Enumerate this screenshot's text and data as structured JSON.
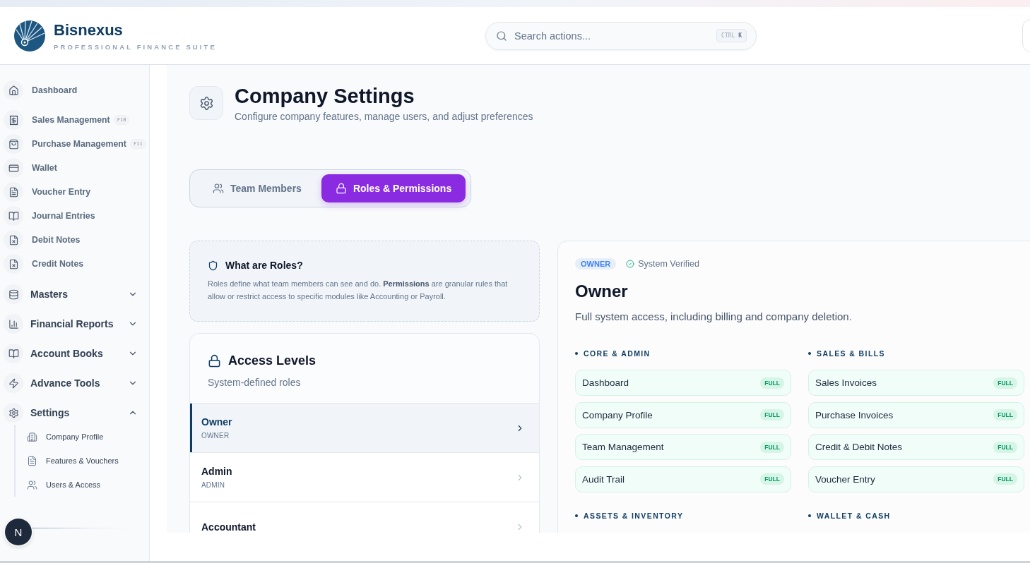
{
  "brand": {
    "name": "Bisnexus",
    "tagline": "PROFESSIONAL FINANCE SUITE"
  },
  "search": {
    "placeholder": "Search actions...",
    "shortcut": "CTRL **K**"
  },
  "sidebar": {
    "items": [
      {
        "kind": "link",
        "label": "Dashboard"
      },
      {
        "kind": "link",
        "label": "Sales Management",
        "shortcut": "F10"
      },
      {
        "kind": "link",
        "label": "Purchase Management",
        "shortcut": "F11"
      },
      {
        "kind": "link",
        "label": "Wallet"
      },
      {
        "kind": "link",
        "label": "Voucher Entry"
      },
      {
        "kind": "link",
        "label": "Journal Entries"
      },
      {
        "kind": "link",
        "label": "Debit Notes"
      },
      {
        "kind": "link",
        "label": "Credit Notes"
      },
      {
        "kind": "group",
        "label": "Masters",
        "expanded": false
      },
      {
        "kind": "group",
        "label": "Financial Reports",
        "expanded": false
      },
      {
        "kind": "group",
        "label": "Account Books",
        "expanded": false
      },
      {
        "kind": "group",
        "label": "Advance Tools",
        "expanded": false
      },
      {
        "kind": "group",
        "label": "Settings",
        "expanded": true,
        "children": [
          {
            "label": "Company Profile"
          },
          {
            "label": "Features & Vouchers"
          },
          {
            "label": "Users & Access"
          }
        ]
      }
    ],
    "avatar": "N"
  },
  "page": {
    "title": "Company Settings",
    "subtitle": "Configure company features, manage users, and adjust preferences"
  },
  "tabs": [
    {
      "label": "Team Members",
      "selected": false
    },
    {
      "label": "Roles & Permissions",
      "selected": true
    }
  ],
  "info": {
    "title": "What are Roles?",
    "text": "Roles define what team members can see and do. **Permissions** are granular rules that allow or restrict access to specific modules like Accounting or Payroll."
  },
  "access_levels": {
    "title": "Access Levels",
    "subtitle": "System-defined roles",
    "roles": [
      {
        "name": "Owner",
        "code": "OWNER",
        "selected": true
      },
      {
        "name": "Admin",
        "code": "ADMIN",
        "selected": false
      },
      {
        "name": "Accountant",
        "selected": false
      }
    ]
  },
  "role_detail": {
    "badge": "OWNER",
    "status": "System Verified",
    "title": "Owner",
    "description": "Full system access, including billing and company deletion.",
    "sections": [
      {
        "title": "CORE & ADMIN",
        "permissions": [
          {
            "name": "Dashboard",
            "access": "FULL"
          },
          {
            "name": "Company Profile",
            "access": "FULL"
          },
          {
            "name": "Team Management",
            "access": "FULL"
          },
          {
            "name": "Audit Trail",
            "access": "FULL"
          }
        ]
      },
      {
        "title": "SALES & BILLS",
        "permissions": [
          {
            "name": "Sales Invoices",
            "access": "FULL"
          },
          {
            "name": "Purchase Invoices",
            "access": "FULL"
          },
          {
            "name": "Credit & Debit Notes",
            "access": "FULL"
          },
          {
            "name": "Voucher Entry",
            "access": "FULL"
          }
        ]
      },
      {
        "title": "ASSETS & INVENTORY"
      },
      {
        "title": "WALLET & CASH"
      }
    ]
  }
}
